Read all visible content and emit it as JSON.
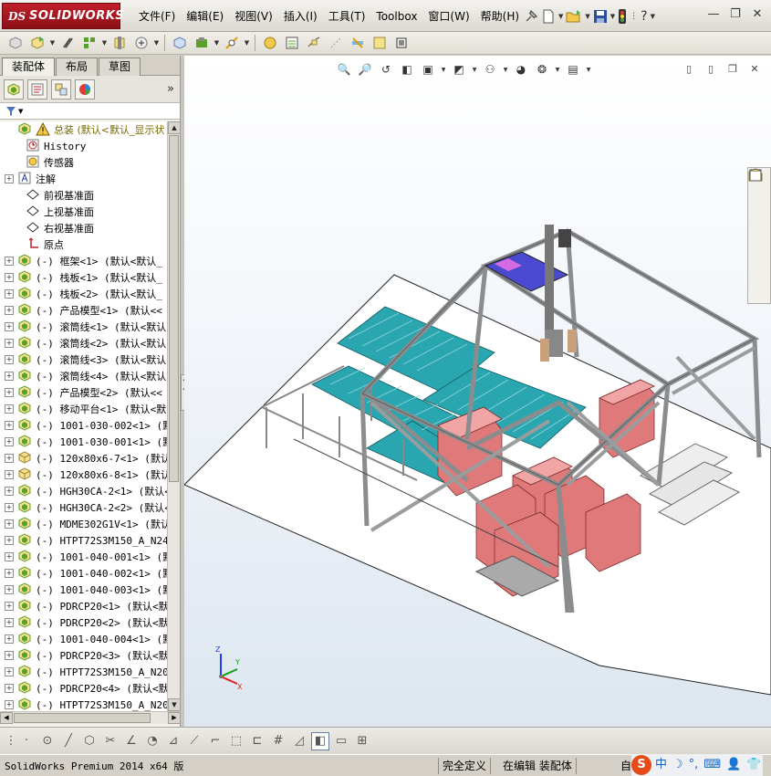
{
  "app": {
    "logo_text": "SOLIDWORKS",
    "logo_ds": "DS"
  },
  "menu": {
    "items": [
      "文件(F)",
      "编辑(E)",
      "视图(V)",
      "插入(I)",
      "工具(T)",
      "Toolbox",
      "窗口(W)",
      "帮助(H)"
    ]
  },
  "panel": {
    "tabs": [
      "装配体",
      "布局",
      "草图"
    ],
    "more_glyph": "»"
  },
  "tree": {
    "root": "总装 (默认<默认_显示状",
    "items": [
      {
        "label": "History",
        "type": "history"
      },
      {
        "label": "传感器",
        "type": "sensor"
      },
      {
        "label": "注解",
        "type": "annotation",
        "expand": true
      },
      {
        "label": "前视基准面",
        "type": "plane"
      },
      {
        "label": "上视基准面",
        "type": "plane"
      },
      {
        "label": "右视基准面",
        "type": "plane"
      },
      {
        "label": "原点",
        "type": "origin"
      },
      {
        "label": "(-) 框架<1> (默认<默认_",
        "type": "asm"
      },
      {
        "label": "(-) 栈板<1> (默认<默认_",
        "type": "asm"
      },
      {
        "label": "(-) 栈板<2> (默认<默认_",
        "type": "asm"
      },
      {
        "label": "(-) 产品模型<1> (默认<<",
        "type": "asm"
      },
      {
        "label": "(-) 滚筒线<1> (默认<默认",
        "type": "asm"
      },
      {
        "label": "(-) 滚筒线<2> (默认<默认",
        "type": "asm"
      },
      {
        "label": "(-) 滚筒线<3> (默认<默认",
        "type": "asm"
      },
      {
        "label": "(-) 滚筒线<4> (默认<默认",
        "type": "asm"
      },
      {
        "label": "(-) 产品模型<2> (默认<<",
        "type": "asm"
      },
      {
        "label": "(-) 移动平台<1> (默认<默",
        "type": "asm"
      },
      {
        "label": "(-) 1001-030-002<1> (默",
        "type": "asm"
      },
      {
        "label": "(-) 1001-030-001<1> (默",
        "type": "asm"
      },
      {
        "label": "(-) 120x80x6-7<1> (默认",
        "type": "part"
      },
      {
        "label": "(-) 120x80x6-8<1> (默认",
        "type": "part"
      },
      {
        "label": "(-) HGH30CA-2<1> (默认<",
        "type": "asm"
      },
      {
        "label": "(-) HGH30CA-2<2> (默认<",
        "type": "asm"
      },
      {
        "label": "(-) MDME302G1V<1> (默认",
        "type": "asm"
      },
      {
        "label": "(-) HTPT72S3M150_A_N24<",
        "type": "asm"
      },
      {
        "label": "(-) 1001-040-001<1> (默",
        "type": "asm"
      },
      {
        "label": "(-) 1001-040-002<1> (默",
        "type": "asm"
      },
      {
        "label": "(-) 1001-040-003<1> (默",
        "type": "asm"
      },
      {
        "label": "(-) PDRCP20<1> (默认<默",
        "type": "asm"
      },
      {
        "label": "(-) PDRCP20<2> (默认<默",
        "type": "asm"
      },
      {
        "label": "(-) 1001-040-004<1> (默",
        "type": "asm"
      },
      {
        "label": "(-) PDRCP20<3> (默认<默",
        "type": "asm"
      },
      {
        "label": "(-) HTPT72S3M150_A_N20<",
        "type": "asm"
      },
      {
        "label": "(-) PDRCP20<4> (默认<默",
        "type": "asm"
      },
      {
        "label": "(-) HTPT72S3M150_A_N20_",
        "type": "asm"
      }
    ]
  },
  "status": {
    "product": "SolidWorks Premium 2014 x64 版",
    "definition": "完全定义",
    "mode": "在编辑 装配体",
    "custom": "自"
  },
  "ime": {
    "items": [
      "S",
      "中",
      "☽",
      "°,",
      "⌨",
      "👤",
      "👕"
    ]
  },
  "colors": {
    "accent": "#c0202a",
    "roller": "#2aa6b0",
    "box": "#e07a7a",
    "frame": "#a7a9ac"
  }
}
